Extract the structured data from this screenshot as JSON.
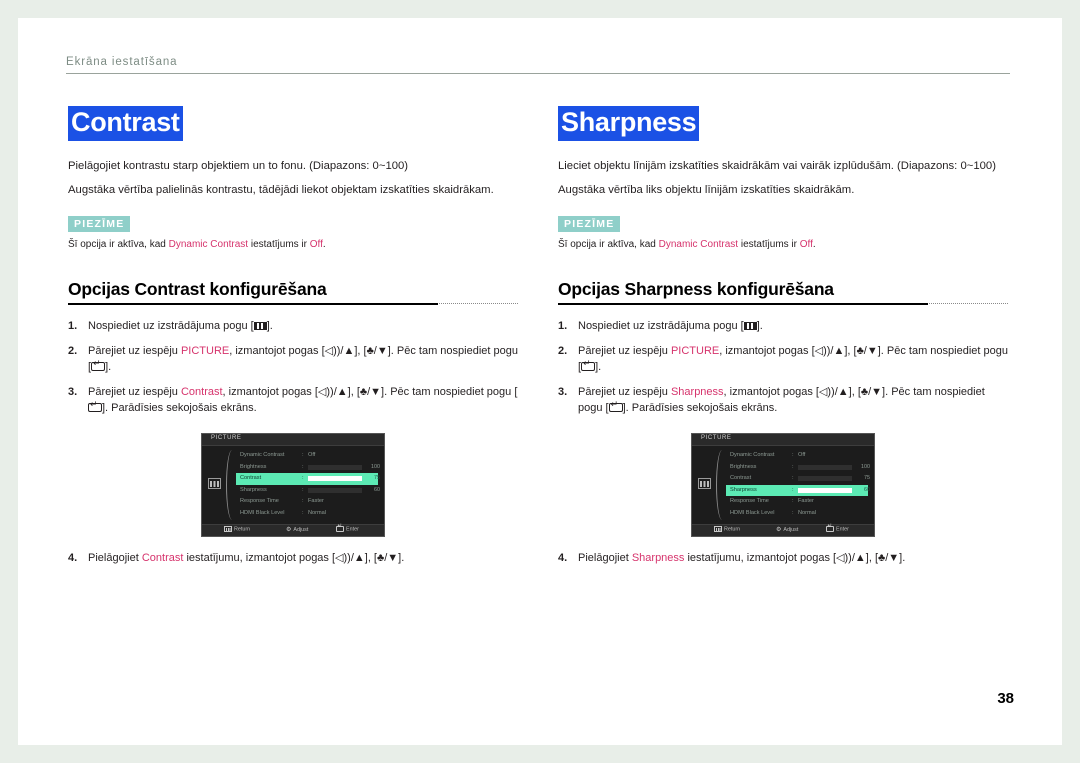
{
  "header": {
    "breadcrumb": "Ekrāna iestatīšana"
  },
  "page_number": "38",
  "columns": [
    {
      "title": "Contrast",
      "desc1": "Pielāgojiet kontrastu starp objektiem un to fonu. (Diapazons: 0~100)",
      "desc2": "Augstāka vērtība palielinās kontrastu, tādējādi liekot objektam izskatīties skaidrākam.",
      "note_badge": "PIEZĪME",
      "note_pre": "Šī opcija ir aktīva, kad ",
      "note_term": "Dynamic Contrast",
      "note_mid": " iestatījums ir ",
      "note_value": "Off",
      "note_post": ".",
      "section_head": "Opcijas Contrast konfigurēšana",
      "steps": [
        {
          "num": "1.",
          "pre": "Nospiediet uz izstrādājuma pogu [",
          "post": "]."
        },
        {
          "num": "2.",
          "pre": "Pārejiet uz iespēju ",
          "term": "PICTURE",
          "mid": ", izmantojot pogas [◁))/▲], [♣/▼]. Pēc tam nospiediet pogu [",
          "post": "]."
        },
        {
          "num": "3.",
          "pre": "Pārejiet uz iespēju ",
          "term": "Contrast",
          "mid": ", izmantojot pogas [◁))/▲], [♣/▼]. Pēc tam nospiediet pogu [",
          "post": "]. Parādīsies sekojošais ekrāns."
        },
        {
          "num": "4.",
          "pre": "Pielāgojiet ",
          "term": "Contrast",
          "mid": " iestatījumu, izmantojot pogas [◁))/▲], [♣/▼].",
          "post": ""
        }
      ],
      "osd": {
        "title": "PICTURE",
        "rows": [
          {
            "label": "Dynamic Contrast",
            "type": "text",
            "value": "Off",
            "selected": false
          },
          {
            "label": "Brightness",
            "type": "bar",
            "value": "100",
            "fill": 96,
            "selected": false
          },
          {
            "label": "Contrast",
            "type": "bar",
            "value": "75",
            "fill": 74,
            "selected": true
          },
          {
            "label": "Sharpness",
            "type": "bar",
            "value": "60",
            "fill": 60,
            "selected": false
          },
          {
            "label": "Response Time",
            "type": "text",
            "value": "Faster",
            "selected": false
          },
          {
            "label": "HDMI Black Level",
            "type": "text",
            "value": "Normal",
            "selected": false
          }
        ],
        "footer": {
          "return": "Return",
          "adjust": "Adjust",
          "enter": "Enter"
        }
      }
    },
    {
      "title": "Sharpness",
      "desc1": "Lieciet objektu līnijām izskatīties skaidrākām vai vairāk izplūdušām. (Diapazons: 0~100)",
      "desc2": "Augstāka vērtība liks objektu līnijām izskatīties skaidrākām.",
      "note_badge": "PIEZĪME",
      "note_pre": "Šī opcija ir aktīva, kad ",
      "note_term": "Dynamic Contrast",
      "note_mid": " iestatījums ir ",
      "note_value": "Off",
      "note_post": ".",
      "section_head": "Opcijas Sharpness konfigurēšana",
      "steps": [
        {
          "num": "1.",
          "pre": "Nospiediet uz izstrādājuma pogu [",
          "post": "]."
        },
        {
          "num": "2.",
          "pre": "Pārejiet uz iespēju ",
          "term": "PICTURE",
          "mid": ", izmantojot pogas [◁))/▲], [♣/▼]. Pēc tam nospiediet pogu [",
          "post": "]."
        },
        {
          "num": "3.",
          "pre": "Pārejiet uz iespēju ",
          "term": "Sharpness",
          "mid": ", izmantojot pogas [◁))/▲], [♣/▼]. Pēc tam nospiediet pogu [",
          "post": "]. Parādīsies sekojošais ekrāns."
        },
        {
          "num": "4.",
          "pre": "Pielāgojiet ",
          "term": "Sharpness",
          "mid": " iestatījumu, izmantojot pogas [◁))/▲], [♣/▼].",
          "post": ""
        }
      ],
      "osd": {
        "title": "PICTURE",
        "rows": [
          {
            "label": "Dynamic Contrast",
            "type": "text",
            "value": "Off",
            "selected": false
          },
          {
            "label": "Brightness",
            "type": "bar",
            "value": "100",
            "fill": 96,
            "selected": false
          },
          {
            "label": "Contrast",
            "type": "bar",
            "value": "75",
            "fill": 74,
            "selected": false
          },
          {
            "label": "Sharpness",
            "type": "bar",
            "value": "60",
            "fill": 60,
            "selected": true
          },
          {
            "label": "Response Time",
            "type": "text",
            "value": "Faster",
            "selected": false
          },
          {
            "label": "HDMI Black Level",
            "type": "text",
            "value": "Normal",
            "selected": false
          }
        ],
        "footer": {
          "return": "Return",
          "adjust": "Adjust",
          "enter": "Enter"
        }
      }
    }
  ],
  "colors": {
    "title_highlight": "#1b51e5",
    "note_badge": "#8fcfc9",
    "accent_pink": "#d6336c",
    "osd_selected": "#5ceab4",
    "page_bg": "#e8eee8"
  }
}
